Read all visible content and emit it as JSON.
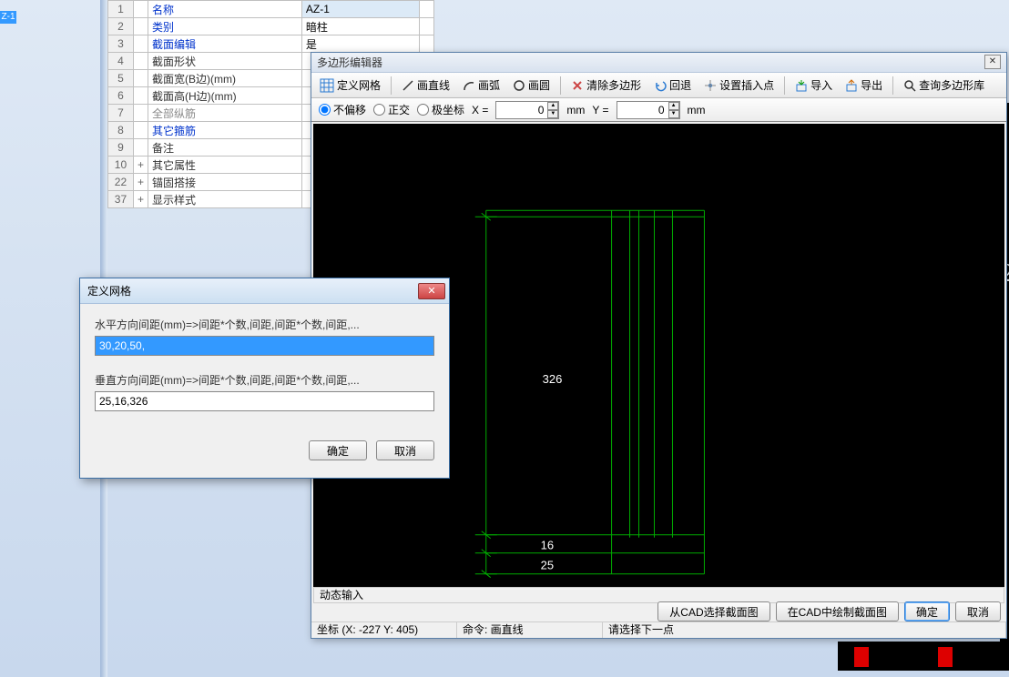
{
  "left_tag": "Z-1",
  "prop_rows": [
    {
      "num": "1",
      "label": "名称",
      "value": "AZ-1",
      "cls": "blue-text",
      "selected": true
    },
    {
      "num": "2",
      "label": "类别",
      "value": "暗柱",
      "cls": "blue-text"
    },
    {
      "num": "3",
      "label": "截面编辑",
      "value": "是",
      "cls": "blue-text"
    },
    {
      "num": "4",
      "label": "截面形状",
      "value": "",
      "cls": "black-text"
    },
    {
      "num": "5",
      "label": "截面宽(B边)(mm)",
      "value": "",
      "cls": "black-text"
    },
    {
      "num": "6",
      "label": "截面高(H边)(mm)",
      "value": "",
      "cls": "black-text"
    },
    {
      "num": "7",
      "label": "全部纵筋",
      "value": "",
      "cls": "gray-text"
    },
    {
      "num": "8",
      "label": "其它箍筋",
      "value": "",
      "cls": "blue-text"
    },
    {
      "num": "9",
      "label": "备注",
      "value": "",
      "cls": "black-text"
    },
    {
      "num": "10",
      "label": "其它属性",
      "value": "",
      "cls": "black-text",
      "expand": "+"
    },
    {
      "num": "22",
      "label": "锚固搭接",
      "value": "",
      "cls": "black-text",
      "expand": "+"
    },
    {
      "num": "37",
      "label": "显示样式",
      "value": "",
      "cls": "black-text",
      "expand": "+"
    }
  ],
  "editor": {
    "title": "多边形编辑器",
    "toolbar": {
      "define_grid": "定义网格",
      "draw_line": "画直线",
      "draw_arc": "画弧",
      "draw_circle": "画圆",
      "clear_poly": "清除多边形",
      "undo": "回退",
      "set_insert": "设置插入点",
      "import": "导入",
      "export": "导出",
      "query_lib": "查询多边形库"
    },
    "options": {
      "no_offset": "不偏移",
      "ortho": "正交",
      "polar": "极坐标",
      "x_label": "X =",
      "x_value": "0",
      "y_label": "Y =",
      "y_value": "0",
      "unit": "mm"
    },
    "dims": {
      "d1": "326",
      "d2": "16",
      "d3": "25"
    },
    "dynamic_input": "动态输入",
    "buttons": {
      "from_cad": "从CAD选择截面图",
      "in_cad": "在CAD中绘制截面图",
      "ok": "确定",
      "cancel": "取消"
    },
    "status": {
      "coords": "坐标 (X: -227 Y: 405)",
      "cmd": "命令: 画直线",
      "prompt": "请选择下一点"
    }
  },
  "grid_dialog": {
    "title": "定义网格",
    "h_label": "水平方向间距(mm)=>间距*个数,间距,间距*个数,间距,...",
    "h_value": "30,20,50,",
    "v_label": "垂直方向间距(mm)=>间距*个数,间距,间距*个数,间距,...",
    "v_value": "25,16,326",
    "ok": "确定",
    "cancel": "取消"
  }
}
